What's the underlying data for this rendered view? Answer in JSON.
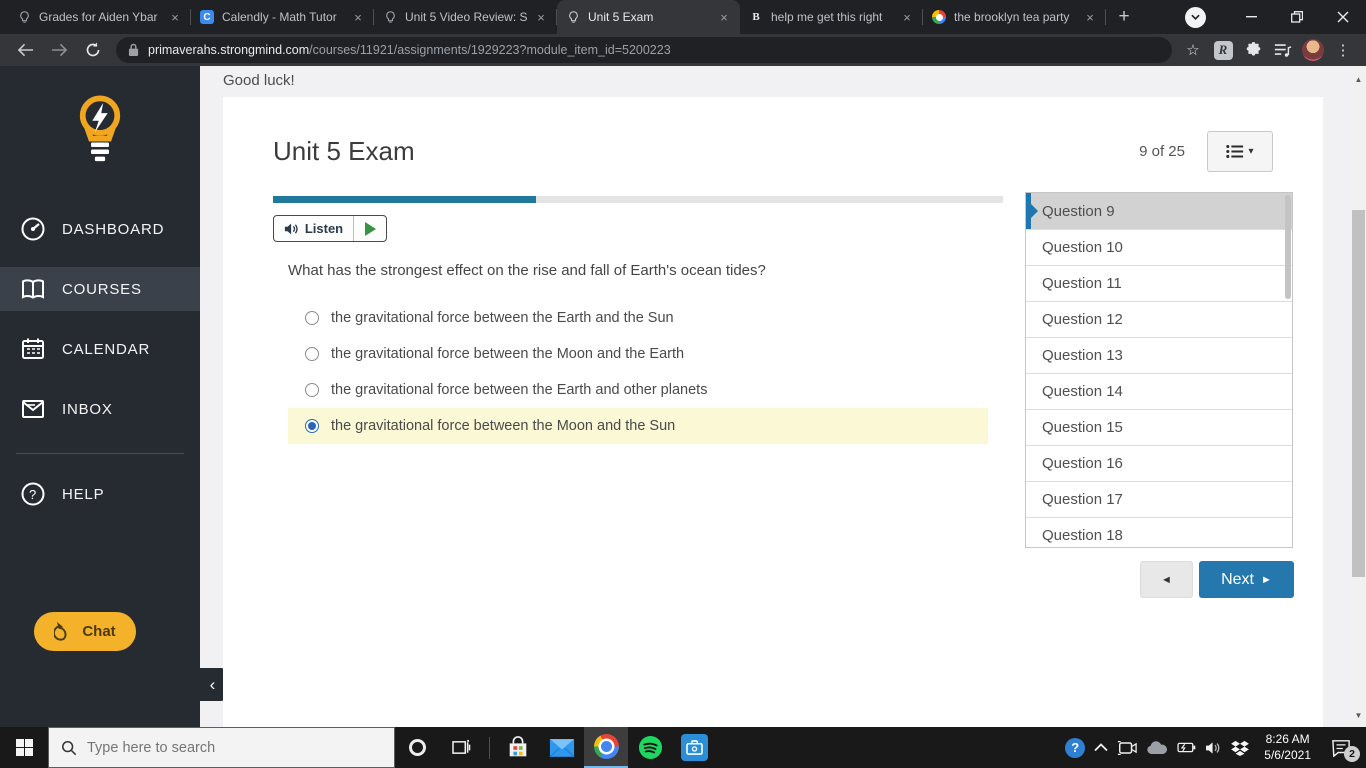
{
  "browser": {
    "tabs": [
      {
        "title": "Grades for Aiden Ybar",
        "favicon": "lightbulb-icon",
        "active": false
      },
      {
        "title": "Calendly - Math Tutor",
        "favicon": "calendly-icon",
        "active": false
      },
      {
        "title": "Unit 5 Video Review: S",
        "favicon": "lightbulb-icon",
        "active": false
      },
      {
        "title": "Unit 5 Exam",
        "favicon": "lightbulb-icon",
        "active": true
      },
      {
        "title": "help me get this right",
        "favicon": "bing-icon",
        "active": false
      },
      {
        "title": "the brooklyn tea party",
        "favicon": "google-icon",
        "active": false
      }
    ],
    "url_host": "primaverahs.strongmind.com",
    "url_path": "/courses/11921/assignments/1929223?module_item_id=5200223"
  },
  "sidebar": {
    "items": [
      {
        "label": "DASHBOARD",
        "icon": "speedometer-icon",
        "active": false
      },
      {
        "label": "COURSES",
        "icon": "book-icon",
        "active": true
      },
      {
        "label": "CALENDAR",
        "icon": "calendar-icon",
        "active": false
      },
      {
        "label": "INBOX",
        "icon": "inbox-icon",
        "active": false
      },
      {
        "label": "HELP",
        "icon": "question-icon",
        "active": false
      }
    ],
    "chat_label": "Chat"
  },
  "exam": {
    "greeting": "Good luck!",
    "title": "Unit 5 Exam",
    "counter": "9 of 25",
    "progress_percent": 36,
    "listen_label": "Listen",
    "question": "What has the strongest effect on the rise and fall of Earth's ocean tides?",
    "options": [
      {
        "label": "the gravitational force between the Earth and the Sun",
        "selected": false
      },
      {
        "label": "the gravitational force between the Moon and the Earth",
        "selected": false
      },
      {
        "label": "the gravitational force between the Earth and other planets",
        "selected": false
      },
      {
        "label": "the gravitational force between the Moon and the Sun",
        "selected": true
      }
    ],
    "nav": [
      {
        "label": "Question 9",
        "active": true
      },
      {
        "label": "Question 10",
        "active": false
      },
      {
        "label": "Question 11",
        "active": false
      },
      {
        "label": "Question 12",
        "active": false
      },
      {
        "label": "Question 13",
        "active": false
      },
      {
        "label": "Question 14",
        "active": false
      },
      {
        "label": "Question 15",
        "active": false
      },
      {
        "label": "Question 16",
        "active": false
      },
      {
        "label": "Question 17",
        "active": false
      },
      {
        "label": "Question 18",
        "active": false
      }
    ],
    "next_label": "Next"
  },
  "taskbar": {
    "search_placeholder": "Type here to search",
    "time": "8:26 AM",
    "date": "5/6/2021",
    "badge": "2"
  },
  "colors": {
    "progress_teal": "#20799a",
    "next_blue": "#2578ae",
    "highlight_yellow": "#fbf8d5",
    "brand_yellow": "#f3b229",
    "sidebar_dark": "#262b32",
    "nav_marker_blue": "#1f77b0"
  }
}
